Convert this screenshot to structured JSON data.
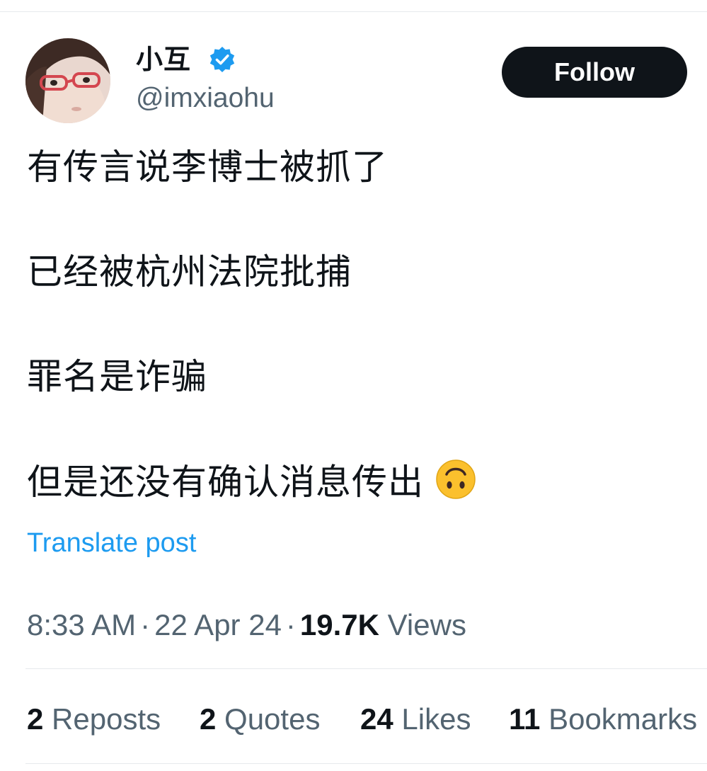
{
  "author": {
    "display_name": "小互",
    "handle": "@imxiaohu",
    "verified_icon": "verified-badge-icon",
    "avatar_icon": "avatar-photo"
  },
  "follow_button": {
    "label": "Follow"
  },
  "tweet": {
    "lines": [
      "有传言说李博士被抓了",
      "已经被杭州法院批捕",
      "罪名是诈骗",
      "但是还没有确认消息传出"
    ],
    "emoji": "upside-down-face-emoji",
    "translate_label": "Translate post"
  },
  "meta": {
    "time": "8:33 AM",
    "date": "22 Apr 24",
    "views_count": "19.7K",
    "views_label": "Views",
    "separator": "·"
  },
  "stats": {
    "reposts": {
      "count": "2",
      "label": "Reposts"
    },
    "quotes": {
      "count": "2",
      "label": "Quotes"
    },
    "likes": {
      "count": "24",
      "label": "Likes"
    },
    "bookmarks": {
      "count": "11",
      "label": "Bookmarks"
    }
  },
  "colors": {
    "text": "#0f1419",
    "secondary": "#536471",
    "link": "#1d9bf0",
    "verified": "#1d9bf0",
    "button_bg": "#0f1419",
    "divider": "#e6e9ec"
  }
}
